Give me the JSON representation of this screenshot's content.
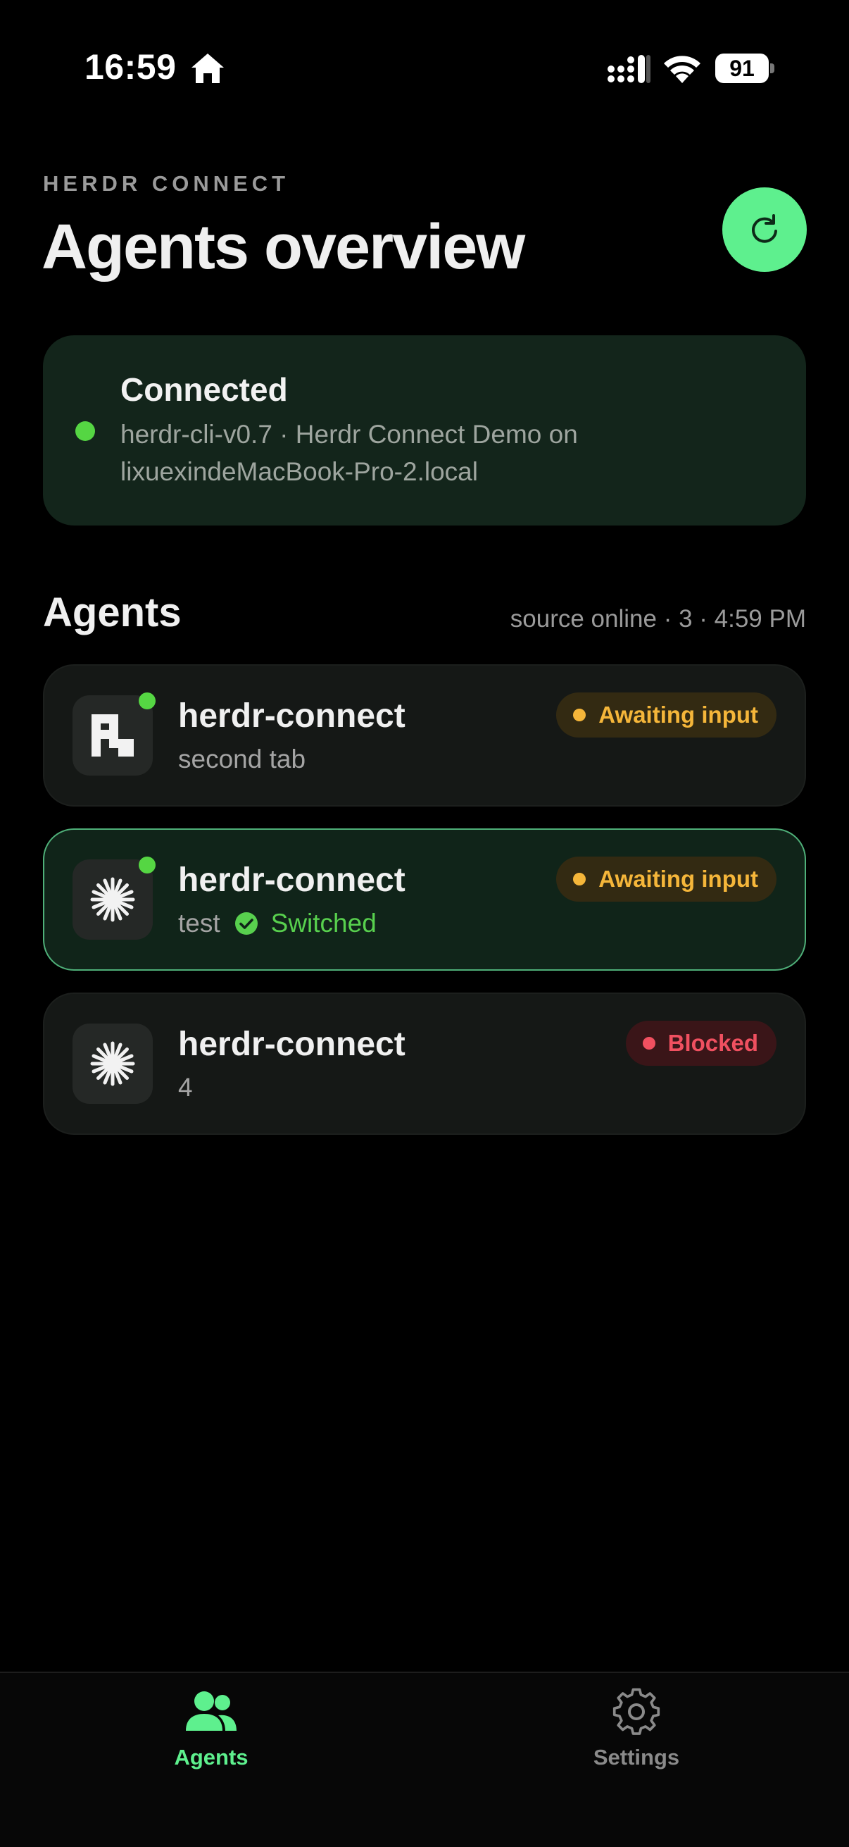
{
  "status_bar": {
    "time": "16:59",
    "battery": "91",
    "icons": [
      "home-icon",
      "signal-icon",
      "wifi-icon",
      "battery-icon"
    ]
  },
  "header": {
    "eyebrow": "HERDR CONNECT",
    "title": "Agents overview",
    "refresh_icon": "refresh-icon"
  },
  "connection": {
    "title": "Connected",
    "description": "herdr-cli-v0.7 · Herdr Connect Demo on lixuexindeMacBook-Pro-2.local"
  },
  "agents_section": {
    "title": "Agents",
    "meta": "source online · 3 · 4:59 PM"
  },
  "agents": [
    {
      "name": "herdr-connect",
      "subtitle": "second tab",
      "status": "Awaiting input",
      "online": true,
      "icon": "herdr-logo-icon"
    },
    {
      "name": "herdr-connect",
      "subtitle": "test",
      "extra": "Switched",
      "status": "Awaiting input",
      "online": true,
      "icon": "sparkle-icon",
      "active": true
    },
    {
      "name": "herdr-connect",
      "subtitle": "4",
      "status": "Blocked",
      "online": false,
      "icon": "sparkle-icon"
    }
  ],
  "tab_bar": {
    "tabs": [
      {
        "label": "Agents",
        "icon": "agents-icon",
        "selected": true
      },
      {
        "label": "Settings",
        "icon": "gear-icon",
        "selected": false
      }
    ]
  },
  "colors": {
    "accent": "#5ef08e",
    "online": "#55d643",
    "awaiting": "#f5b63a",
    "blocked": "#f05060",
    "card": "#151816",
    "connected_card": "#13251b"
  }
}
